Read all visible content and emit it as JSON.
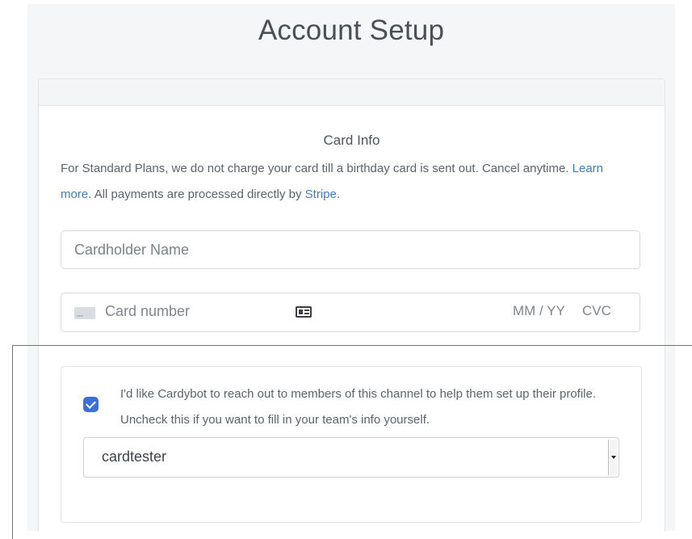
{
  "page": {
    "title": "Account Setup"
  },
  "card_info": {
    "title": "Card Info",
    "description_part1": "For Standard Plans, we do not charge your card till a birthday card is sent out. Cancel anytime. ",
    "learn_more_link": "Learn more",
    "description_part2": ". All payments are processed directly by ",
    "stripe_link": "Stripe",
    "description_part3": "."
  },
  "form": {
    "cardholder_name_placeholder": "Cardholder Name",
    "card_number_placeholder": "Card number",
    "expiry_placeholder": "MM / YY",
    "cvc_placeholder": "CVC"
  },
  "consent": {
    "checked": true,
    "text": "I'd like Cardybot to reach out to members of this channel to help them set up their profile. Uncheck this if you want to fill in your team's info yourself.",
    "channel_selected": "cardtester"
  },
  "icons": {
    "card_brand": "credit-card-icon",
    "autofill": "contact-card-icon",
    "checkbox": "checkmark-icon",
    "select": "caret-down-icon"
  },
  "colors": {
    "link": "#3f7bc8",
    "checkbox": "#3d6fd8",
    "highlight": "#e0463f"
  }
}
